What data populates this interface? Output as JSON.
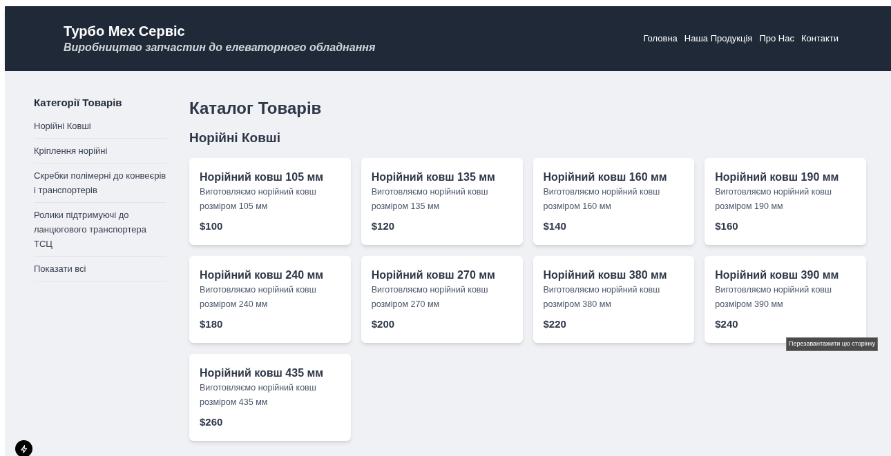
{
  "header": {
    "title": "Турбо Мех Сервіс",
    "subtitle": "Виробництво запчастин до елеваторного обладнання",
    "nav": [
      "Головна",
      "Наша Продукція",
      "Про Нас",
      "Контакти"
    ]
  },
  "sidebar": {
    "title": "Категорії Товарів",
    "items": [
      "Норійні Ковші",
      "Кріплення норійні",
      "Скребки полімерні до конвеєрів і транспортерів",
      "Ролики підтримуючі до ланцюгового транспортера ТСЦ",
      "Показати всі"
    ]
  },
  "catalog": {
    "title": "Каталог Товарів",
    "section": "Норійні Ковші",
    "products": [
      {
        "name": "Норійний ковш 105 мм",
        "description": "Виготовляємо норійний ковш розміром 105 мм",
        "price": "$100"
      },
      {
        "name": "Норійний ковш 135 мм",
        "description": "Виготовляємо норійний ковш розміром 135 мм",
        "price": "$120"
      },
      {
        "name": "Норійний ковш 160 мм",
        "description": "Виготовляємо норійний ковш розміром 160 мм",
        "price": "$140"
      },
      {
        "name": "Норійний ковш 190 мм",
        "description": "Виготовляємо норійний ковш розміром 190 мм",
        "price": "$160"
      },
      {
        "name": "Норійний ковш 240 мм",
        "description": "Виготовляємо норійний ковш розміром 240 мм",
        "price": "$180"
      },
      {
        "name": "Норійний ковш 270 мм",
        "description": "Виготовляємо норійний ковш розміром 270 мм",
        "price": "$200"
      },
      {
        "name": "Норійний ковш 380 мм",
        "description": "Виготовляємо норійний ковш розміром 380 мм",
        "price": "$220"
      },
      {
        "name": "Норійний ковш 390 мм",
        "description": "Виготовляємо норійний ковш розміром 390 мм",
        "price": "$240"
      },
      {
        "name": "Норійний ковш 435 мм",
        "description": "Виготовляємо норійний ковш розміром 435 мм",
        "price": "$260"
      }
    ]
  },
  "tooltip": "Перезавантажити цю сторінку"
}
